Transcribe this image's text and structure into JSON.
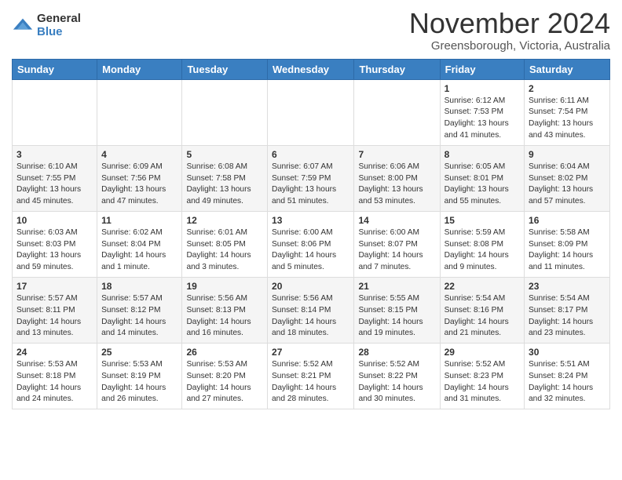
{
  "header": {
    "logo_general": "General",
    "logo_blue": "Blue",
    "month_title": "November 2024",
    "location": "Greensborough, Victoria, Australia"
  },
  "weekdays": [
    "Sunday",
    "Monday",
    "Tuesday",
    "Wednesday",
    "Thursday",
    "Friday",
    "Saturday"
  ],
  "weeks": [
    [
      {
        "day": "",
        "info": ""
      },
      {
        "day": "",
        "info": ""
      },
      {
        "day": "",
        "info": ""
      },
      {
        "day": "",
        "info": ""
      },
      {
        "day": "",
        "info": ""
      },
      {
        "day": "1",
        "info": "Sunrise: 6:12 AM\nSunset: 7:53 PM\nDaylight: 13 hours\nand 41 minutes."
      },
      {
        "day": "2",
        "info": "Sunrise: 6:11 AM\nSunset: 7:54 PM\nDaylight: 13 hours\nand 43 minutes."
      }
    ],
    [
      {
        "day": "3",
        "info": "Sunrise: 6:10 AM\nSunset: 7:55 PM\nDaylight: 13 hours\nand 45 minutes."
      },
      {
        "day": "4",
        "info": "Sunrise: 6:09 AM\nSunset: 7:56 PM\nDaylight: 13 hours\nand 47 minutes."
      },
      {
        "day": "5",
        "info": "Sunrise: 6:08 AM\nSunset: 7:58 PM\nDaylight: 13 hours\nand 49 minutes."
      },
      {
        "day": "6",
        "info": "Sunrise: 6:07 AM\nSunset: 7:59 PM\nDaylight: 13 hours\nand 51 minutes."
      },
      {
        "day": "7",
        "info": "Sunrise: 6:06 AM\nSunset: 8:00 PM\nDaylight: 13 hours\nand 53 minutes."
      },
      {
        "day": "8",
        "info": "Sunrise: 6:05 AM\nSunset: 8:01 PM\nDaylight: 13 hours\nand 55 minutes."
      },
      {
        "day": "9",
        "info": "Sunrise: 6:04 AM\nSunset: 8:02 PM\nDaylight: 13 hours\nand 57 minutes."
      }
    ],
    [
      {
        "day": "10",
        "info": "Sunrise: 6:03 AM\nSunset: 8:03 PM\nDaylight: 13 hours\nand 59 minutes."
      },
      {
        "day": "11",
        "info": "Sunrise: 6:02 AM\nSunset: 8:04 PM\nDaylight: 14 hours\nand 1 minute."
      },
      {
        "day": "12",
        "info": "Sunrise: 6:01 AM\nSunset: 8:05 PM\nDaylight: 14 hours\nand 3 minutes."
      },
      {
        "day": "13",
        "info": "Sunrise: 6:00 AM\nSunset: 8:06 PM\nDaylight: 14 hours\nand 5 minutes."
      },
      {
        "day": "14",
        "info": "Sunrise: 6:00 AM\nSunset: 8:07 PM\nDaylight: 14 hours\nand 7 minutes."
      },
      {
        "day": "15",
        "info": "Sunrise: 5:59 AM\nSunset: 8:08 PM\nDaylight: 14 hours\nand 9 minutes."
      },
      {
        "day": "16",
        "info": "Sunrise: 5:58 AM\nSunset: 8:09 PM\nDaylight: 14 hours\nand 11 minutes."
      }
    ],
    [
      {
        "day": "17",
        "info": "Sunrise: 5:57 AM\nSunset: 8:11 PM\nDaylight: 14 hours\nand 13 minutes."
      },
      {
        "day": "18",
        "info": "Sunrise: 5:57 AM\nSunset: 8:12 PM\nDaylight: 14 hours\nand 14 minutes."
      },
      {
        "day": "19",
        "info": "Sunrise: 5:56 AM\nSunset: 8:13 PM\nDaylight: 14 hours\nand 16 minutes."
      },
      {
        "day": "20",
        "info": "Sunrise: 5:56 AM\nSunset: 8:14 PM\nDaylight: 14 hours\nand 18 minutes."
      },
      {
        "day": "21",
        "info": "Sunrise: 5:55 AM\nSunset: 8:15 PM\nDaylight: 14 hours\nand 19 minutes."
      },
      {
        "day": "22",
        "info": "Sunrise: 5:54 AM\nSunset: 8:16 PM\nDaylight: 14 hours\nand 21 minutes."
      },
      {
        "day": "23",
        "info": "Sunrise: 5:54 AM\nSunset: 8:17 PM\nDaylight: 14 hours\nand 23 minutes."
      }
    ],
    [
      {
        "day": "24",
        "info": "Sunrise: 5:53 AM\nSunset: 8:18 PM\nDaylight: 14 hours\nand 24 minutes."
      },
      {
        "day": "25",
        "info": "Sunrise: 5:53 AM\nSunset: 8:19 PM\nDaylight: 14 hours\nand 26 minutes."
      },
      {
        "day": "26",
        "info": "Sunrise: 5:53 AM\nSunset: 8:20 PM\nDaylight: 14 hours\nand 27 minutes."
      },
      {
        "day": "27",
        "info": "Sunrise: 5:52 AM\nSunset: 8:21 PM\nDaylight: 14 hours\nand 28 minutes."
      },
      {
        "day": "28",
        "info": "Sunrise: 5:52 AM\nSunset: 8:22 PM\nDaylight: 14 hours\nand 30 minutes."
      },
      {
        "day": "29",
        "info": "Sunrise: 5:52 AM\nSunset: 8:23 PM\nDaylight: 14 hours\nand 31 minutes."
      },
      {
        "day": "30",
        "info": "Sunrise: 5:51 AM\nSunset: 8:24 PM\nDaylight: 14 hours\nand 32 minutes."
      }
    ]
  ]
}
